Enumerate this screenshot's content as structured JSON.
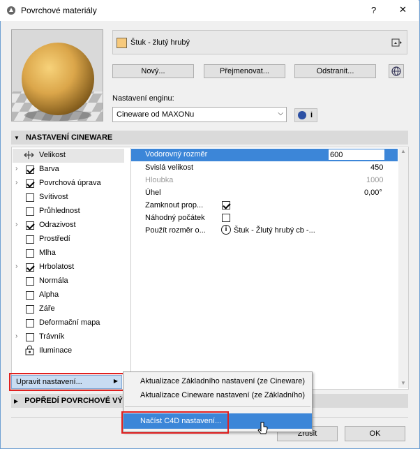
{
  "window": {
    "title": "Povrchové materiály",
    "help": "?",
    "close": "✕"
  },
  "material": {
    "name": "Štuk - žlutý hrubý",
    "swatch_color": "#f6c97c"
  },
  "buttons": {
    "new": "Nový...",
    "rename": "Přejmenovat...",
    "delete": "Odstranit...",
    "cancel": "Zrušit",
    "ok": "OK"
  },
  "engine": {
    "label": "Nastavení enginu:",
    "value": "Cineware od MAXONu",
    "info": "i"
  },
  "section_cineware": "NASTAVENÍ CINEWARE",
  "section_foreground": "POPŘEDÍ POVRCHOVÉ VÝPL",
  "channels": [
    {
      "label": "Velikost",
      "checked": null,
      "expand": false
    },
    {
      "label": "Barva",
      "checked": true,
      "expand": true
    },
    {
      "label": "Povrchová úprava",
      "checked": true,
      "expand": true
    },
    {
      "label": "Svítivost",
      "checked": false,
      "expand": false
    },
    {
      "label": "Průhlednost",
      "checked": false,
      "expand": false
    },
    {
      "label": "Odrazivost",
      "checked": true,
      "expand": true
    },
    {
      "label": "Prostředí",
      "checked": false,
      "expand": false
    },
    {
      "label": "Mlha",
      "checked": false,
      "expand": false
    },
    {
      "label": "Hrbolatost",
      "checked": true,
      "expand": true
    },
    {
      "label": "Normála",
      "checked": false,
      "expand": false
    },
    {
      "label": "Alpha",
      "checked": false,
      "expand": false
    },
    {
      "label": "Záře",
      "checked": false,
      "expand": false
    },
    {
      "label": "Deformační mapa",
      "checked": false,
      "expand": false
    },
    {
      "label": "Trávník",
      "checked": false,
      "expand": true
    },
    {
      "label": "Iluminace",
      "checked": null,
      "expand": false
    }
  ],
  "properties": {
    "horizontal": {
      "name": "Vodorovný rozměr",
      "value": "600"
    },
    "vertical": {
      "name": "Svislá velikost",
      "value": "450"
    },
    "depth": {
      "name": "Hloubka",
      "value": "1000"
    },
    "angle": {
      "name": "Úhel",
      "value": "0,00°"
    },
    "lock": {
      "name": "Zamknout prop..."
    },
    "random": {
      "name": "Náhodný počátek"
    },
    "use_size": {
      "name": "Použít rozměr o...",
      "value": "Štuk - Žlutý hrubý cb -..."
    }
  },
  "edit_settings": {
    "label": "Upravit nastavení..."
  },
  "submenu": [
    "Aktualizace Základního nastavení (ze Cineware)",
    "Aktualizace Cineware nastavení (ze Základního)",
    "Načíst C4D nastavení..."
  ]
}
